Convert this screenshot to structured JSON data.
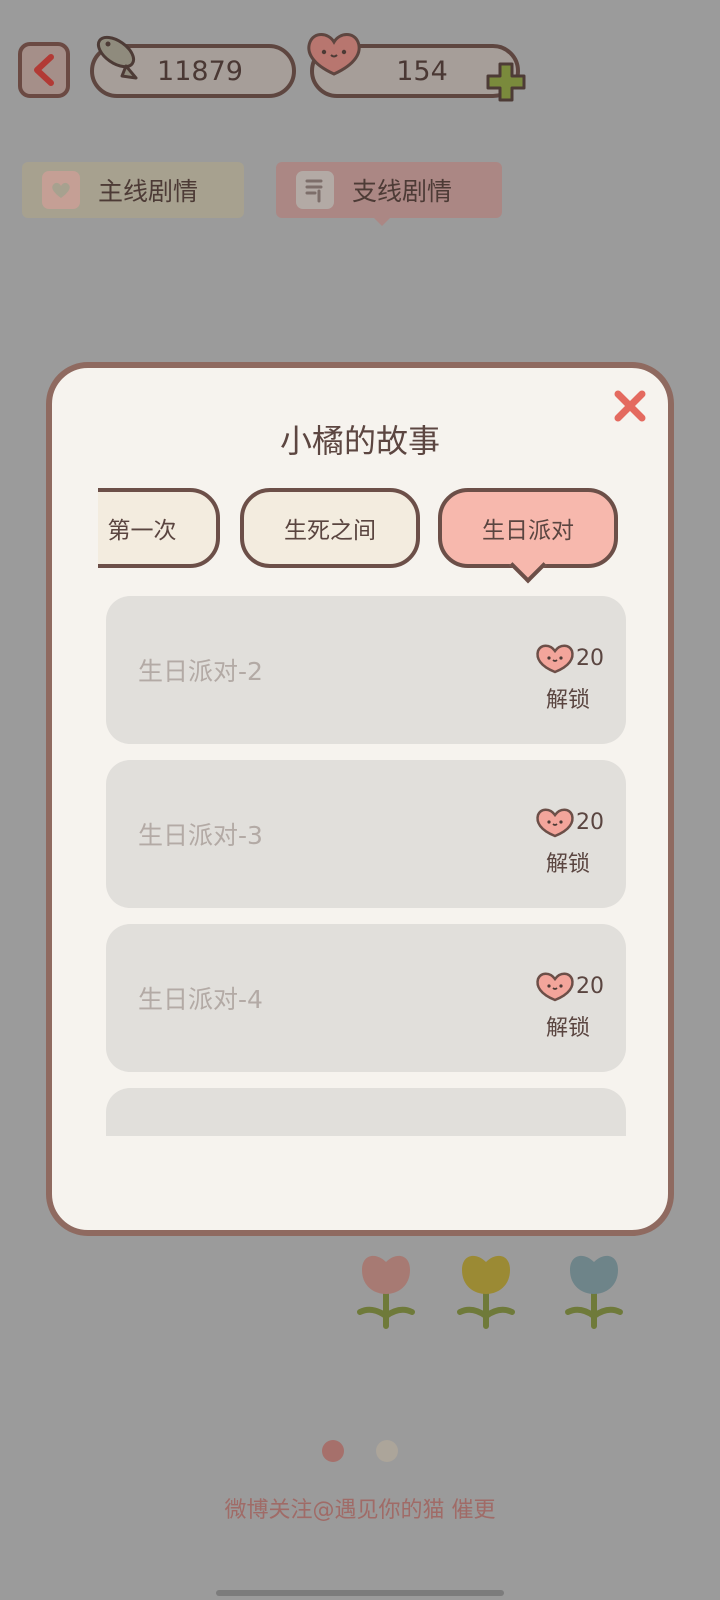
{
  "topbar": {
    "back_icon": "chevron-left-icon",
    "fish_icon": "fish-icon",
    "fish_count": "11879",
    "heart_icon": "heart-face-icon",
    "heart_count": "154",
    "add_icon": "plus-icon"
  },
  "tabs": [
    {
      "label": "主线剧情",
      "icon": "heart-box-icon"
    },
    {
      "label": "支线剧情",
      "icon": "document-icon"
    }
  ],
  "modal": {
    "title": "小橘的故事",
    "close_icon": "close-icon",
    "chapters": [
      {
        "label": "第一次"
      },
      {
        "label": "生死之间"
      },
      {
        "label": "生日派对"
      }
    ],
    "active_chapter": "生日派对",
    "items": [
      {
        "title": "生日派对-2",
        "cost": "20",
        "action": "解锁"
      },
      {
        "title": "生日派对-3",
        "cost": "20",
        "action": "解锁"
      },
      {
        "title": "生日派对-4",
        "cost": "20",
        "action": "解锁"
      },
      {
        "title": "",
        "cost": "",
        "action": ""
      }
    ]
  },
  "footer": {
    "text": "微博关注@遇见你的猫 催更"
  },
  "colors": {
    "overlay": "#9b9b9b",
    "accent_pink": "#f7b8ad",
    "close_red": "#e46a5f",
    "border_brown": "#6c4f48"
  }
}
